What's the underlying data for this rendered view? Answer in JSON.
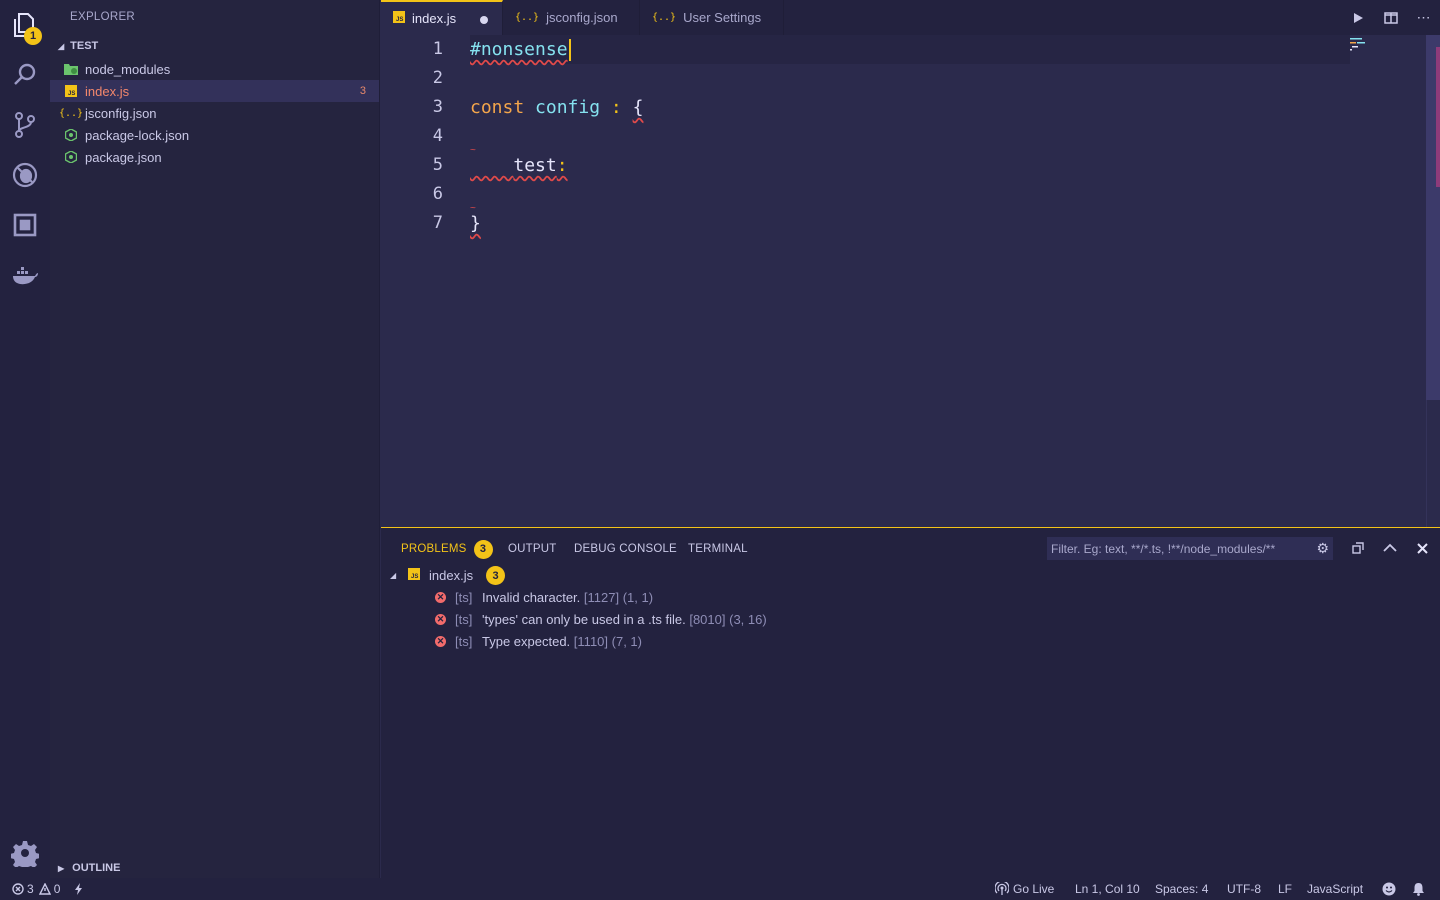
{
  "activity": {
    "items": [
      {
        "name": "explorer-icon"
      },
      {
        "name": "search-icon"
      },
      {
        "name": "source-control-icon"
      },
      {
        "name": "debug-icon"
      },
      {
        "name": "extensions-icon"
      },
      {
        "name": "docker-icon"
      }
    ],
    "explorer_badge": "1",
    "settings_icon": "gear-icon"
  },
  "sidebar": {
    "title": "EXPLORER",
    "section": "TEST",
    "files": [
      {
        "label": "node_modules",
        "icon": "folder-icon",
        "count": ""
      },
      {
        "label": "index.js",
        "icon": "js-file-icon",
        "count": "3"
      },
      {
        "label": "jsconfig.json",
        "icon": "json-file-icon",
        "count": ""
      },
      {
        "label": "package-lock.json",
        "icon": "npm-file-icon",
        "count": ""
      },
      {
        "label": "package.json",
        "icon": "npm-file-icon",
        "count": ""
      }
    ],
    "outline": "OUTLINE"
  },
  "tabs": [
    {
      "label": "index.js",
      "icon": "JS"
    },
    {
      "label": "jsconfig.json",
      "icon": "{..}"
    },
    {
      "label": "User Settings",
      "icon": "{..}"
    }
  ],
  "editor": {
    "line_numbers": [
      "1",
      "2",
      "3",
      "4",
      "5",
      "6",
      "7"
    ],
    "code": {
      "l1": "#nonsense",
      "l3_kw": "const",
      "l3_id": "config",
      "l3_colon": ":",
      "l3_brace": "{",
      "l5_prop": "test",
      "l5_colon": ":",
      "l7_brace": "}"
    }
  },
  "panel": {
    "tabs": {
      "problems": "PROBLEMS",
      "problems_count": "3",
      "output": "OUTPUT",
      "debug_console": "DEBUG CONSOLE",
      "terminal": "TERMINAL"
    },
    "filter_placeholder": "Filter. Eg: text, **/*.ts, !**/node_modules/**",
    "file": {
      "label": "index.js",
      "count": "3"
    },
    "problems": [
      {
        "source": "[ts]",
        "message": "Invalid character.",
        "code": "[1127]",
        "position": "(1, 1)"
      },
      {
        "source": "[ts]",
        "message": "'types' can only be used in a .ts file.",
        "code": "[8010]",
        "position": "(3, 16)"
      },
      {
        "source": "[ts]",
        "message": "Type expected.",
        "code": "[1110]",
        "position": "(7, 1)"
      }
    ]
  },
  "status": {
    "errors": "3",
    "warnings": "0",
    "go_live": "Go Live",
    "cursor": "Ln 1, Col 10",
    "spaces": "Spaces: 4",
    "encoding": "UTF-8",
    "eol": "LF",
    "language": "JavaScript"
  },
  "colors": {
    "accent": "#f3c318",
    "background": "#2b2a4c",
    "error": "#f26b6b"
  }
}
